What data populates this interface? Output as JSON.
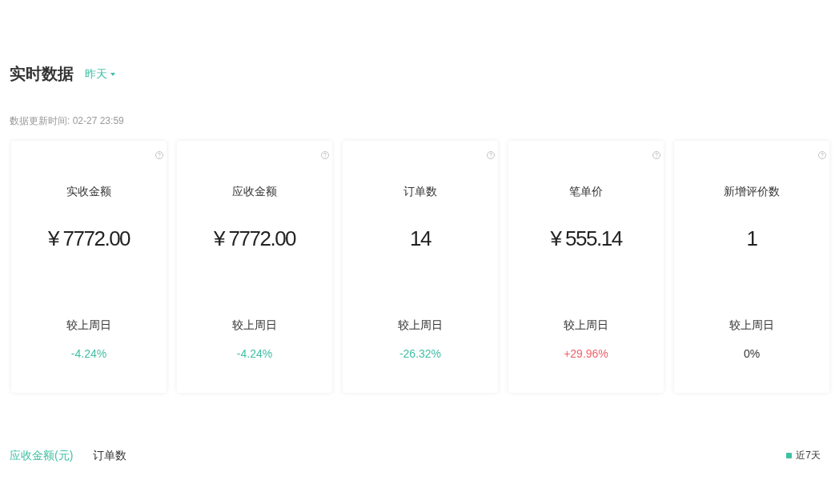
{
  "header": {
    "title": "实时数据",
    "period": {
      "label": "昨天"
    }
  },
  "updated": "数据更新时间: 02-27 23:59",
  "metrics": [
    {
      "label": "实收金额",
      "value": "¥ 7772.00",
      "compare_label": "较上周日",
      "change": "-4.24%",
      "color": "#3fbfa4"
    },
    {
      "label": "应收金额",
      "value": "¥ 7772.00",
      "compare_label": "较上周日",
      "change": "-4.24%",
      "color": "#3fbfa4"
    },
    {
      "label": "订单数",
      "value": "14",
      "compare_label": "较上周日",
      "change": "-26.32%",
      "color": "#3fbfa4"
    },
    {
      "label": "笔单价",
      "value": "¥ 555.14",
      "compare_label": "较上周日",
      "change": "+29.96%",
      "color": "#f0616a"
    },
    {
      "label": "新增评价数",
      "value": "1",
      "compare_label": "较上周日",
      "change": "0%",
      "color": "#333333"
    }
  ],
  "chart_tabs": [
    {
      "label": "应收金额(元)",
      "selected": true
    },
    {
      "label": "订单数",
      "selected": false
    }
  ],
  "legend": [
    {
      "label": "近7天",
      "color": "#3fbfa4"
    }
  ]
}
